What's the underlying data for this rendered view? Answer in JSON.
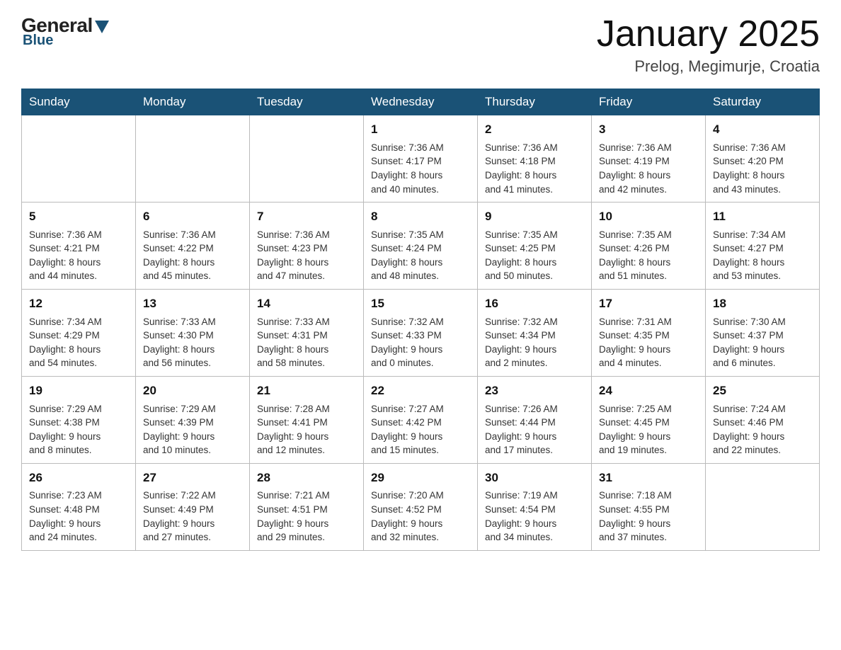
{
  "header": {
    "logo": {
      "general": "General",
      "blue": "Blue"
    },
    "title": "January 2025",
    "location": "Prelog, Megimurje, Croatia"
  },
  "days_of_week": [
    "Sunday",
    "Monday",
    "Tuesday",
    "Wednesday",
    "Thursday",
    "Friday",
    "Saturday"
  ],
  "weeks": [
    [
      {
        "day": "",
        "info": ""
      },
      {
        "day": "",
        "info": ""
      },
      {
        "day": "",
        "info": ""
      },
      {
        "day": "1",
        "info": "Sunrise: 7:36 AM\nSunset: 4:17 PM\nDaylight: 8 hours\nand 40 minutes."
      },
      {
        "day": "2",
        "info": "Sunrise: 7:36 AM\nSunset: 4:18 PM\nDaylight: 8 hours\nand 41 minutes."
      },
      {
        "day": "3",
        "info": "Sunrise: 7:36 AM\nSunset: 4:19 PM\nDaylight: 8 hours\nand 42 minutes."
      },
      {
        "day": "4",
        "info": "Sunrise: 7:36 AM\nSunset: 4:20 PM\nDaylight: 8 hours\nand 43 minutes."
      }
    ],
    [
      {
        "day": "5",
        "info": "Sunrise: 7:36 AM\nSunset: 4:21 PM\nDaylight: 8 hours\nand 44 minutes."
      },
      {
        "day": "6",
        "info": "Sunrise: 7:36 AM\nSunset: 4:22 PM\nDaylight: 8 hours\nand 45 minutes."
      },
      {
        "day": "7",
        "info": "Sunrise: 7:36 AM\nSunset: 4:23 PM\nDaylight: 8 hours\nand 47 minutes."
      },
      {
        "day": "8",
        "info": "Sunrise: 7:35 AM\nSunset: 4:24 PM\nDaylight: 8 hours\nand 48 minutes."
      },
      {
        "day": "9",
        "info": "Sunrise: 7:35 AM\nSunset: 4:25 PM\nDaylight: 8 hours\nand 50 minutes."
      },
      {
        "day": "10",
        "info": "Sunrise: 7:35 AM\nSunset: 4:26 PM\nDaylight: 8 hours\nand 51 minutes."
      },
      {
        "day": "11",
        "info": "Sunrise: 7:34 AM\nSunset: 4:27 PM\nDaylight: 8 hours\nand 53 minutes."
      }
    ],
    [
      {
        "day": "12",
        "info": "Sunrise: 7:34 AM\nSunset: 4:29 PM\nDaylight: 8 hours\nand 54 minutes."
      },
      {
        "day": "13",
        "info": "Sunrise: 7:33 AM\nSunset: 4:30 PM\nDaylight: 8 hours\nand 56 minutes."
      },
      {
        "day": "14",
        "info": "Sunrise: 7:33 AM\nSunset: 4:31 PM\nDaylight: 8 hours\nand 58 minutes."
      },
      {
        "day": "15",
        "info": "Sunrise: 7:32 AM\nSunset: 4:33 PM\nDaylight: 9 hours\nand 0 minutes."
      },
      {
        "day": "16",
        "info": "Sunrise: 7:32 AM\nSunset: 4:34 PM\nDaylight: 9 hours\nand 2 minutes."
      },
      {
        "day": "17",
        "info": "Sunrise: 7:31 AM\nSunset: 4:35 PM\nDaylight: 9 hours\nand 4 minutes."
      },
      {
        "day": "18",
        "info": "Sunrise: 7:30 AM\nSunset: 4:37 PM\nDaylight: 9 hours\nand 6 minutes."
      }
    ],
    [
      {
        "day": "19",
        "info": "Sunrise: 7:29 AM\nSunset: 4:38 PM\nDaylight: 9 hours\nand 8 minutes."
      },
      {
        "day": "20",
        "info": "Sunrise: 7:29 AM\nSunset: 4:39 PM\nDaylight: 9 hours\nand 10 minutes."
      },
      {
        "day": "21",
        "info": "Sunrise: 7:28 AM\nSunset: 4:41 PM\nDaylight: 9 hours\nand 12 minutes."
      },
      {
        "day": "22",
        "info": "Sunrise: 7:27 AM\nSunset: 4:42 PM\nDaylight: 9 hours\nand 15 minutes."
      },
      {
        "day": "23",
        "info": "Sunrise: 7:26 AM\nSunset: 4:44 PM\nDaylight: 9 hours\nand 17 minutes."
      },
      {
        "day": "24",
        "info": "Sunrise: 7:25 AM\nSunset: 4:45 PM\nDaylight: 9 hours\nand 19 minutes."
      },
      {
        "day": "25",
        "info": "Sunrise: 7:24 AM\nSunset: 4:46 PM\nDaylight: 9 hours\nand 22 minutes."
      }
    ],
    [
      {
        "day": "26",
        "info": "Sunrise: 7:23 AM\nSunset: 4:48 PM\nDaylight: 9 hours\nand 24 minutes."
      },
      {
        "day": "27",
        "info": "Sunrise: 7:22 AM\nSunset: 4:49 PM\nDaylight: 9 hours\nand 27 minutes."
      },
      {
        "day": "28",
        "info": "Sunrise: 7:21 AM\nSunset: 4:51 PM\nDaylight: 9 hours\nand 29 minutes."
      },
      {
        "day": "29",
        "info": "Sunrise: 7:20 AM\nSunset: 4:52 PM\nDaylight: 9 hours\nand 32 minutes."
      },
      {
        "day": "30",
        "info": "Sunrise: 7:19 AM\nSunset: 4:54 PM\nDaylight: 9 hours\nand 34 minutes."
      },
      {
        "day": "31",
        "info": "Sunrise: 7:18 AM\nSunset: 4:55 PM\nDaylight: 9 hours\nand 37 minutes."
      },
      {
        "day": "",
        "info": ""
      }
    ]
  ]
}
